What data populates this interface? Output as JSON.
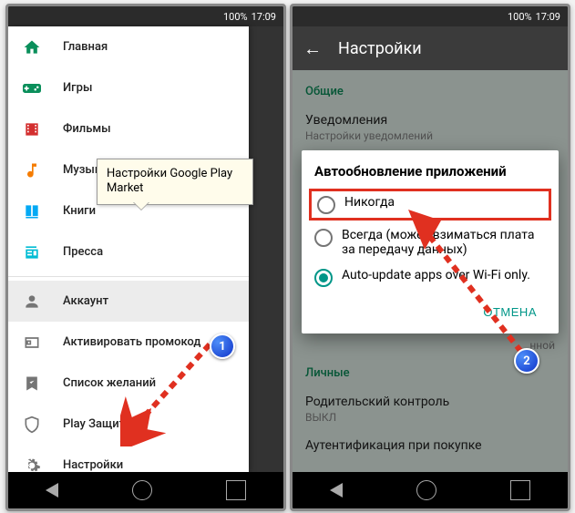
{
  "status": {
    "battery": "100%",
    "time": "17:09"
  },
  "drawer": {
    "items": [
      {
        "label": "Главная"
      },
      {
        "label": "Игры"
      },
      {
        "label": "Фильмы"
      },
      {
        "label": "Музыка"
      },
      {
        "label": "Книги"
      },
      {
        "label": "Пресса"
      },
      {
        "label": "Аккаунт"
      },
      {
        "label": "Активировать промокод"
      },
      {
        "label": "Список желаний"
      },
      {
        "label": "Play Защита"
      },
      {
        "label": "Настройки"
      }
    ]
  },
  "callout": {
    "text": "Настройки Google Play Market"
  },
  "badges": {
    "one": "1",
    "two": "2"
  },
  "right": {
    "title": "Настройки",
    "sections": {
      "general": "Общие",
      "notifications_title": "Уведомления",
      "notifications_sub": "Настройки уведомлений",
      "personal": "Личные",
      "parental_title": "Родительский контроль",
      "parental_sub": "ВЫКЛ",
      "auth_title": "Аутентификация при покупке",
      "after_option": "нной"
    },
    "dialog": {
      "title": "Автообновление приложений",
      "opt1": "Никогда",
      "opt2": "Всегда (может взиматься плата за передачу данных)",
      "opt3": "Auto-update apps over Wi-Fi only.",
      "cancel": "ОТМЕНА"
    }
  }
}
